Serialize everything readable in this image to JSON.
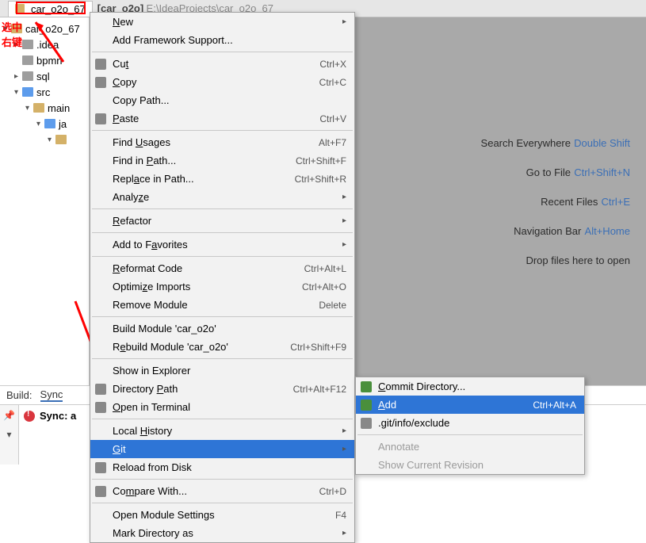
{
  "tab": {
    "title": "car_o2o_67",
    "subtitle": "[car_o2o]",
    "path": "E:\\IdeaProjects\\car_o2o_67"
  },
  "annotation": {
    "line1": "选中",
    "line2": "右键"
  },
  "tree": {
    "root": "car_o2o_67",
    "idea": ".idea",
    "bpmn": "bpmn",
    "sql": "sql",
    "src": "src",
    "main": "main",
    "ja": "ja"
  },
  "menu": {
    "new": "New",
    "add_framework": "Add Framework Support...",
    "cut": "Cut",
    "cut_sc": "Ctrl+X",
    "copy": "Copy",
    "copy_sc": "Ctrl+C",
    "copy_path": "Copy Path...",
    "paste": "Paste",
    "paste_sc": "Ctrl+V",
    "find_usages": "Find Usages",
    "find_usages_sc": "Alt+F7",
    "find_in_path": "Find in Path...",
    "find_in_path_sc": "Ctrl+Shift+F",
    "replace_in_path": "Replace in Path...",
    "replace_in_path_sc": "Ctrl+Shift+R",
    "analyze": "Analyze",
    "refactor": "Refactor",
    "add_favorites": "Add to Favorites",
    "reformat": "Reformat Code",
    "reformat_sc": "Ctrl+Alt+L",
    "optimize": "Optimize Imports",
    "optimize_sc": "Ctrl+Alt+O",
    "remove_module": "Remove Module",
    "remove_module_sc": "Delete",
    "build_module": "Build Module 'car_o2o'",
    "rebuild_module": "Rebuild Module 'car_o2o'",
    "rebuild_sc": "Ctrl+Shift+F9",
    "show_explorer": "Show in Explorer",
    "directory_path": "Directory Path",
    "directory_path_sc": "Ctrl+Alt+F12",
    "open_terminal": "Open in Terminal",
    "local_history": "Local History",
    "git": "Git",
    "reload_disk": "Reload from Disk",
    "compare_with": "Compare With...",
    "compare_with_sc": "Ctrl+D",
    "open_module_settings": "Open Module Settings",
    "open_module_settings_sc": "F4",
    "mark_directory": "Mark Directory as"
  },
  "submenu": {
    "commit_dir": "Commit Directory...",
    "add": "Add",
    "add_sc": "Ctrl+Alt+A",
    "git_info_exclude": ".git/info/exclude",
    "annotate": "Annotate",
    "show_current": "Show Current Revision"
  },
  "hints": {
    "search": "Search Everywhere",
    "search_sc": "Double Shift",
    "gotofile": "Go to File",
    "gotofile_sc": "Ctrl+Shift+N",
    "recent": "Recent Files",
    "recent_sc": "Ctrl+E",
    "navbar": "Navigation Bar",
    "navbar_sc": "Alt+Home",
    "drop": "Drop files here to open"
  },
  "bottom": {
    "build": "Build:",
    "sync_tab": "Sync",
    "sync_msg": "Sync: a"
  }
}
